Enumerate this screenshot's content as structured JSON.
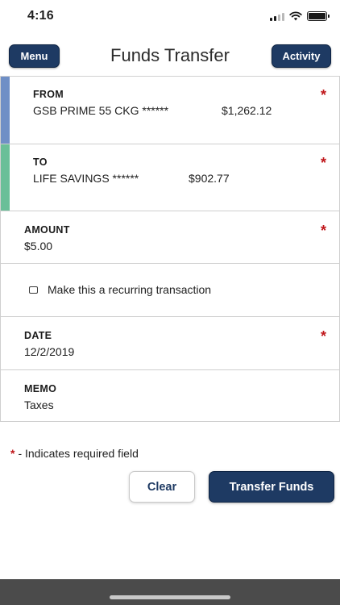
{
  "status_bar": {
    "time": "4:16",
    "icons": [
      "cellular-signal-icon",
      "wifi-icon",
      "battery-icon"
    ]
  },
  "header": {
    "menu_label": "Menu",
    "title": "Funds Transfer",
    "activity_label": "Activity"
  },
  "form": {
    "from": {
      "label": "FROM",
      "account": "GSB PRIME 55 CKG ******",
      "balance": "$1,262.12",
      "required": "*"
    },
    "to": {
      "label": "TO",
      "account": "LIFE SAVINGS ******",
      "balance": "$902.77",
      "required": "*"
    },
    "amount": {
      "label": "AMOUNT",
      "value": "$5.00",
      "required": "*"
    },
    "recurring": {
      "label": "Make this a recurring transaction",
      "checked": false
    },
    "date": {
      "label": "DATE",
      "value": "12/2/2019",
      "required": "*"
    },
    "memo": {
      "label": "MEMO",
      "value": "Taxes"
    }
  },
  "footnote": {
    "star": "*",
    "text": "- Indicates required field"
  },
  "actions": {
    "clear_label": "Clear",
    "transfer_label": "Transfer Funds"
  },
  "colors": {
    "primary": "#1e3a63",
    "required": "#c0171b",
    "from_stripe": "#6f8fc6",
    "to_stripe": "#6abf98"
  }
}
